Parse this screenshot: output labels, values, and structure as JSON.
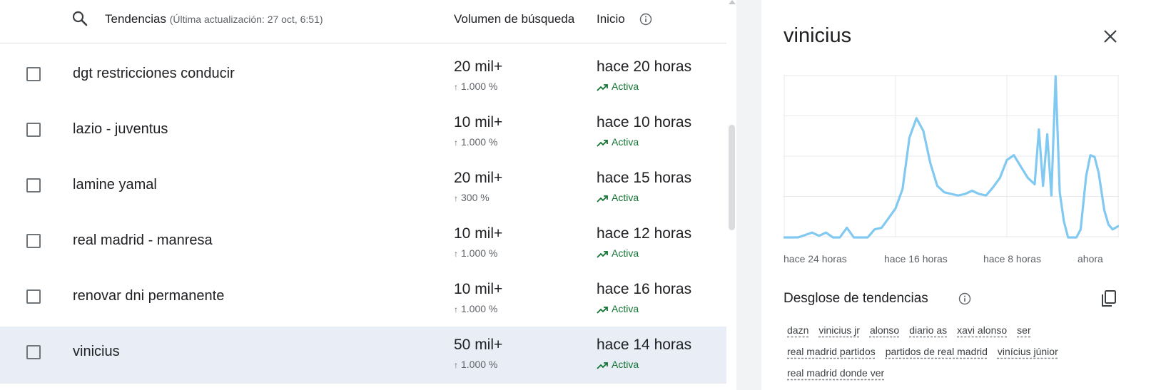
{
  "header": {
    "title": "Tendencias",
    "subtitle": "(Última actualización: 27 oct, 6:51)",
    "volume_col": "Volumen de búsqueda",
    "start_col": "Inicio"
  },
  "rows": [
    {
      "term": "dgt restricciones conducir",
      "volume": "20 mil+",
      "change": "1.000 %",
      "start": "hace 20 horas",
      "status": "Activa"
    },
    {
      "term": "lazio - juventus",
      "volume": "10 mil+",
      "change": "1.000 %",
      "start": "hace 10 horas",
      "status": "Activa"
    },
    {
      "term": "lamine yamal",
      "volume": "20 mil+",
      "change": "300 %",
      "start": "hace 15 horas",
      "status": "Activa"
    },
    {
      "term": "real madrid - manresa",
      "volume": "10 mil+",
      "change": "1.000 %",
      "start": "hace 12 horas",
      "status": "Activa"
    },
    {
      "term": "renovar dni permanente",
      "volume": "10 mil+",
      "change": "1.000 %",
      "start": "hace 16 horas",
      "status": "Activa"
    },
    {
      "term": "vinicius",
      "volume": "50 mil+",
      "change": "1.000 %",
      "start": "hace 14 horas",
      "status": "Activa"
    }
  ],
  "panel": {
    "title": "vinicius",
    "breakdown_title": "Desglose de tendencias",
    "chips": [
      [
        "dazn",
        "vinicius jr",
        "alonso",
        "diario as",
        "xavi alonso",
        "ser"
      ],
      [
        "real madrid partidos",
        "partidos de real madrid",
        "vinícius júnior"
      ],
      [
        "real madrid donde ver"
      ]
    ]
  },
  "chart_data": {
    "type": "line",
    "x_tick_labels": [
      "hace 24 horas",
      "hace 16 horas",
      "hace 8 horas",
      "ahora"
    ],
    "x_range_hours": [
      -24,
      0
    ],
    "y_range": [
      0,
      100
    ],
    "grid": true,
    "line_color": "#81c9f0",
    "series": [
      {
        "x": [
          -24,
          -23,
          -22,
          -21.5,
          -21,
          -20.5,
          -20,
          -19.5,
          -19,
          -18.5,
          -18,
          -17.5,
          -17,
          -16.5,
          -16,
          -15.5,
          -15,
          -14.5,
          -14,
          -13.5,
          -13,
          -12.5,
          -12,
          -11.5,
          -11,
          -10.5,
          -10,
          -9.5,
          -9,
          -8.5,
          -8,
          -7.5,
          -7,
          -6.5,
          -6,
          -5.7,
          -5.4,
          -5.1,
          -4.8,
          -4.5,
          -4.2,
          -3.9,
          -3.6,
          -3.3,
          -3,
          -2.7,
          -2.3,
          -2,
          -1.7,
          -1.4,
          -1,
          -0.7,
          -0.4,
          0
        ],
        "y": [
          0,
          0,
          3,
          1,
          3,
          0,
          0,
          6,
          0,
          0,
          0,
          5,
          6,
          12,
          18,
          30,
          62,
          74,
          66,
          46,
          32,
          28,
          27,
          26,
          27,
          29,
          27,
          26,
          31,
          37,
          48,
          51,
          44,
          37,
          33,
          67,
          32,
          64,
          26,
          100,
          28,
          10,
          0,
          0,
          0,
          5,
          38,
          51,
          50,
          40,
          17,
          8,
          5,
          7
        ]
      }
    ]
  }
}
